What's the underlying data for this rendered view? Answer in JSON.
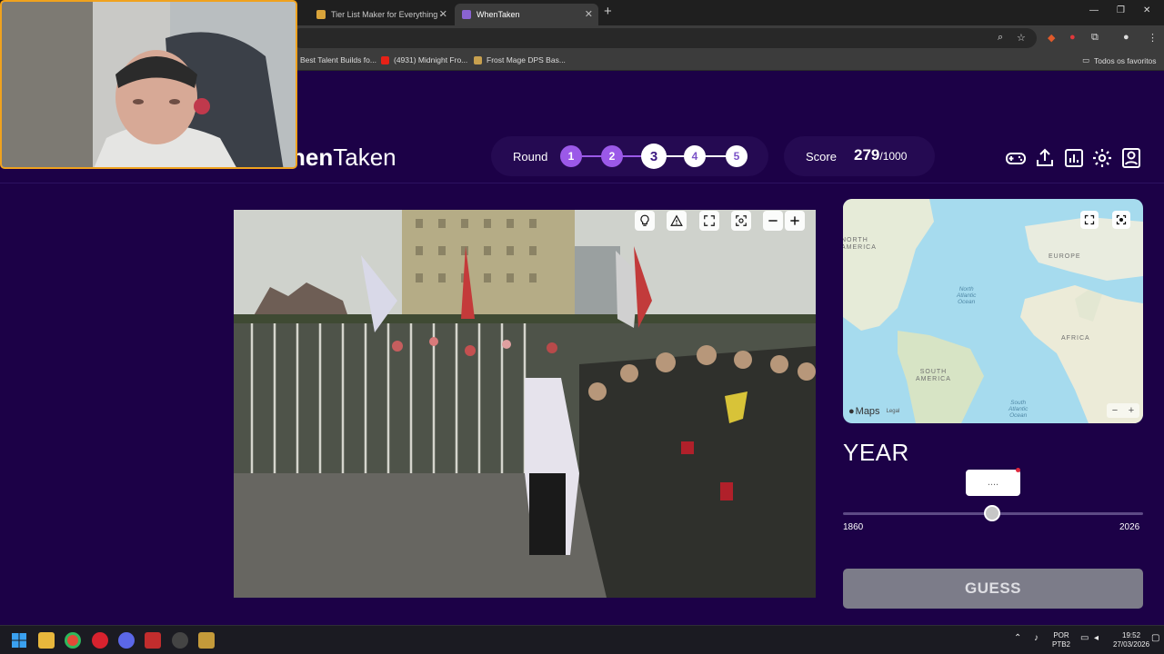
{
  "browser": {
    "tabs": [
      {
        "title": "Tier List Maker for Everything -",
        "active": false
      },
      {
        "title": "WhenTaken",
        "active": true
      }
    ],
    "new_tab": "+",
    "bookmarks": [
      "Best Talent Builds fo...",
      "(4931) Midnight Fro...",
      "Frost Mage DPS Bas..."
    ],
    "all_favorites": "Todos os favoritos"
  },
  "game": {
    "logo_bold": "hen",
    "logo_light": "Taken",
    "round_label": "Round",
    "rounds": [
      "1",
      "2",
      "3",
      "4",
      "5"
    ],
    "current_round": 3,
    "score_label": "Score",
    "score_value": "279",
    "score_max": "/1000",
    "header_icons": [
      "gamepad-icon",
      "share-icon",
      "stats-icon",
      "settings-icon",
      "profile-icon"
    ],
    "photo_tools": [
      "hint-icon",
      "report-icon",
      "fullscreen-icon",
      "focus-icon",
      "zoom-out-icon",
      "zoom-in-icon"
    ]
  },
  "map": {
    "labels": {
      "north_america": "NORTH\nAMERICA",
      "europe": "EUROPE",
      "africa": "AFRICA",
      "south_america": "SOUTH\nAMERICA",
      "north_atlantic": "North\nAtlantic\nOcean",
      "south_atlantic": "South\nAtlantic\nOcean"
    },
    "attribution": "Maps",
    "legal": "Legal"
  },
  "year": {
    "title": "YEAR",
    "bubble_value": "....",
    "min": "1860",
    "max": "2026",
    "fraction": 0.5
  },
  "guess_label": "GUESS",
  "taskbar": {
    "lang_top": "POR",
    "lang_bottom": "PTB2",
    "time": "19:52",
    "date": "27/03/2026"
  }
}
